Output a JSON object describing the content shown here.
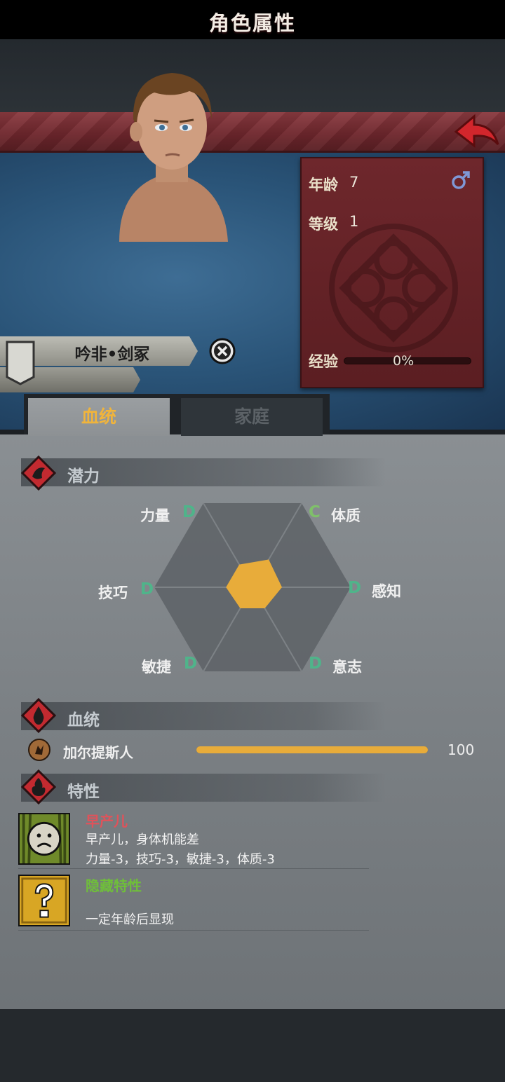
{
  "header": {
    "title": "角色属性"
  },
  "character": {
    "name": "吟非•剑冢",
    "age_label": "年龄",
    "age": "7",
    "level_label": "等级",
    "level": "1",
    "exp_label": "经验",
    "exp_text": "0%",
    "exp_progress": 0
  },
  "tabs": [
    {
      "label": "血统",
      "active": true
    },
    {
      "label": "家庭",
      "active": false
    }
  ],
  "potential": {
    "title": "潜力",
    "attributes": [
      {
        "name": "力量",
        "grade": "D"
      },
      {
        "name": "体质",
        "grade": "C"
      },
      {
        "name": "感知",
        "grade": "D"
      },
      {
        "name": "意志",
        "grade": "D"
      },
      {
        "name": "敏捷",
        "grade": "D"
      },
      {
        "name": "技巧",
        "grade": "D"
      }
    ],
    "radar_levels": [
      0.27,
      0.33,
      0.3,
      0.25,
      0.25,
      0.27
    ]
  },
  "bloodline": {
    "title": "血统",
    "items": [
      {
        "name": "加尔提斯人",
        "value": "100",
        "progress": 1.0
      }
    ]
  },
  "traits": {
    "title": "特性",
    "items": [
      {
        "name": "早产儿",
        "desc1": "早产儿，身体机能差",
        "desc2": "力量-3，技巧-3，敏捷-3，体质-3"
      },
      {
        "name": "隐藏特性",
        "desc1": "",
        "desc2": "一定年龄后显现"
      }
    ]
  },
  "colors": {
    "accent_gold": "#f0b43c",
    "grade_d": "#4fb48a",
    "grade_c": "#7fc06a",
    "trait_red": "#e0525a",
    "trait_green": "#6fbf3a"
  },
  "icons": [
    "back-arrow-icon",
    "male-icon",
    "close-icon",
    "banner-icon",
    "potential-icon",
    "bloodline-icon",
    "trait-icon",
    "crest-icon",
    "sad-face-icon",
    "question-icon"
  ]
}
